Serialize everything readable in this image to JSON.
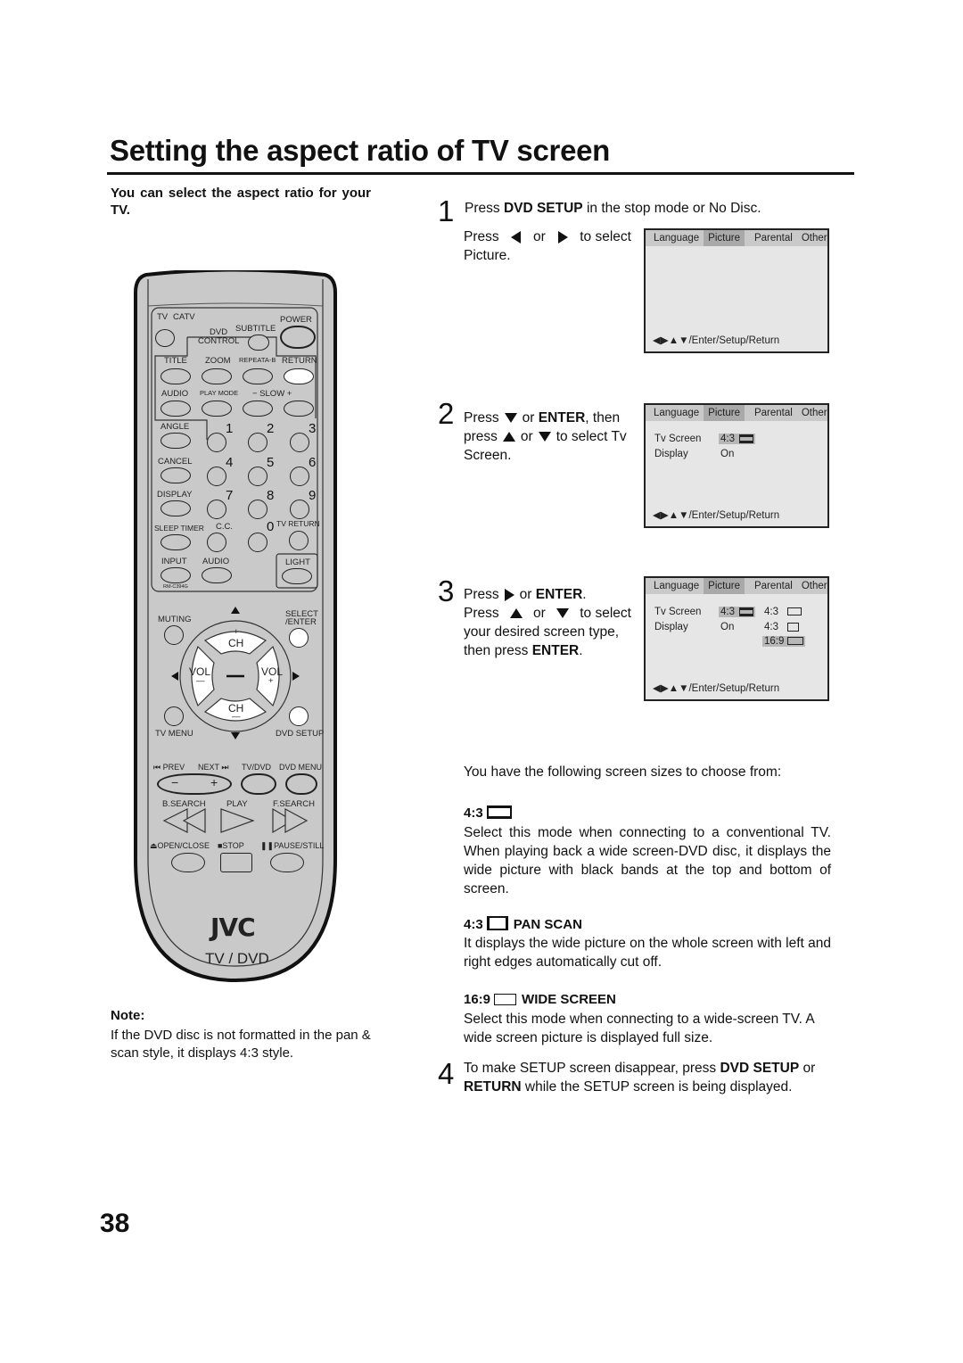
{
  "page": {
    "title": "Setting the aspect ratio of TV screen",
    "intro": "You can select the aspect ratio for your TV.",
    "page_number": "38"
  },
  "note": {
    "heading": "Note:",
    "text": "If the DVD disc is not formatted in the pan & scan style, it displays 4:3 style."
  },
  "remote": {
    "labels": {
      "tv": "TV",
      "catv": "CATV",
      "dvd_control": "DVD CONTROL",
      "dvd": "DVD",
      "control": "CONTROL",
      "subtitle": "SUBTITLE",
      "power": "POWER",
      "title": "TITLE",
      "zoom": "ZOOM",
      "repeat": "REPEATA-B",
      "return": "RETURN",
      "audio": "AUDIO",
      "play_mode": "PLAY MODE",
      "slow": "−  SLOW  +",
      "angle": "ANGLE",
      "cancel": "CANCEL",
      "display": "DISPLAY",
      "sleep_timer": "SLEEP TIMER",
      "cc": "C.C.",
      "tv_return": "TV RETURN",
      "input": "INPUT",
      "audio2": "AUDIO",
      "light": "LIGHT",
      "model": "RM-C394G",
      "muting": "MUTING",
      "select_enter": "SELECT /ENTER",
      "select": "SELECT",
      "enter": "/ENTER",
      "ch_plus": "+",
      "ch": "CH",
      "ch_minus": "—",
      "vol": "VOL",
      "vol_minus": "—",
      "vol_plus": "+",
      "tv_menu": "TV MENU",
      "dvd_setup": "DVD SETUP",
      "prev": "⏮ PREV",
      "next": "NEXT ⏭",
      "tv_dvd": "TV/DVD",
      "dvd_menu": "DVD MENU",
      "b_search": "B.SEARCH",
      "play": "PLAY",
      "f_search": "F.SEARCH",
      "open_close": "⏏OPEN/CLOSE",
      "stop": "■STOP",
      "pause_still": "❚❚PAUSE/STILL",
      "minus": "−",
      "plus": "+",
      "dots": "∘∘∘",
      "brand": "JVC",
      "model_line": "TV / DVD"
    },
    "digits": [
      "1",
      "2",
      "3",
      "4",
      "5",
      "6",
      "7",
      "8",
      "9",
      "0"
    ]
  },
  "steps": [
    {
      "number": "1",
      "line1_pre": "Press ",
      "line1_bold": "DVD SETUP",
      "line1_post": " in the stop mode or No Disc.",
      "line2_a": "Press",
      "line2_b": "or",
      "line2_c": "to select",
      "line2_d": "Picture."
    },
    {
      "number": "2",
      "a": "Press",
      "b": "or",
      "bold1": "ENTER",
      "c": ", then",
      "d": "press",
      "e": "or",
      "f": "to select Tv",
      "g": "Screen."
    },
    {
      "number": "3",
      "a": "Press",
      "b": "or",
      "bold1": "ENTER",
      "c": ".",
      "d": "Press",
      "e": "or",
      "f": "to select",
      "g": "your desired screen type,",
      "h": "then press",
      "bold2": "ENTER",
      "i": "."
    },
    {
      "number": "4",
      "a": "To make SETUP screen disappear, press ",
      "bold1": "DVD SETUP",
      "b": " or",
      "bold2": "RETURN",
      "c": " while the SETUP screen is being displayed."
    }
  ],
  "osd": {
    "tabs": [
      "Language",
      "Picture",
      "Parental",
      "Other"
    ],
    "selected_tab": "Picture",
    "footer": "◀▶▲▼/Enter/Setup/Return",
    "tv_screen_label": "Tv Screen",
    "tv_screen_value": "4:3",
    "display_label": "Display",
    "display_value": "On",
    "options": [
      "4:3",
      "4:3",
      "16:9"
    ],
    "selected_option": "16:9"
  },
  "sizes": {
    "intro": "You have the following screen sizes to choose from:",
    "modes": [
      {
        "ratio": "4:3",
        "name": "",
        "icon": "letterbox-icon",
        "desc": "Select this mode when connecting to a conventional TV. When playing back a wide screen-DVD disc, it displays the wide picture with black bands at the top and bottom of screen."
      },
      {
        "ratio": "4:3",
        "name": "PAN SCAN",
        "icon": "pan-scan-icon",
        "desc": "It displays the wide picture on the whole screen with left and right edges automatically cut off."
      },
      {
        "ratio": "16:9",
        "name": "WIDE SCREEN",
        "icon": "wide-screen-icon",
        "desc": "Select this mode when connecting to a wide-screen TV. A wide screen picture is displayed full size."
      }
    ]
  }
}
